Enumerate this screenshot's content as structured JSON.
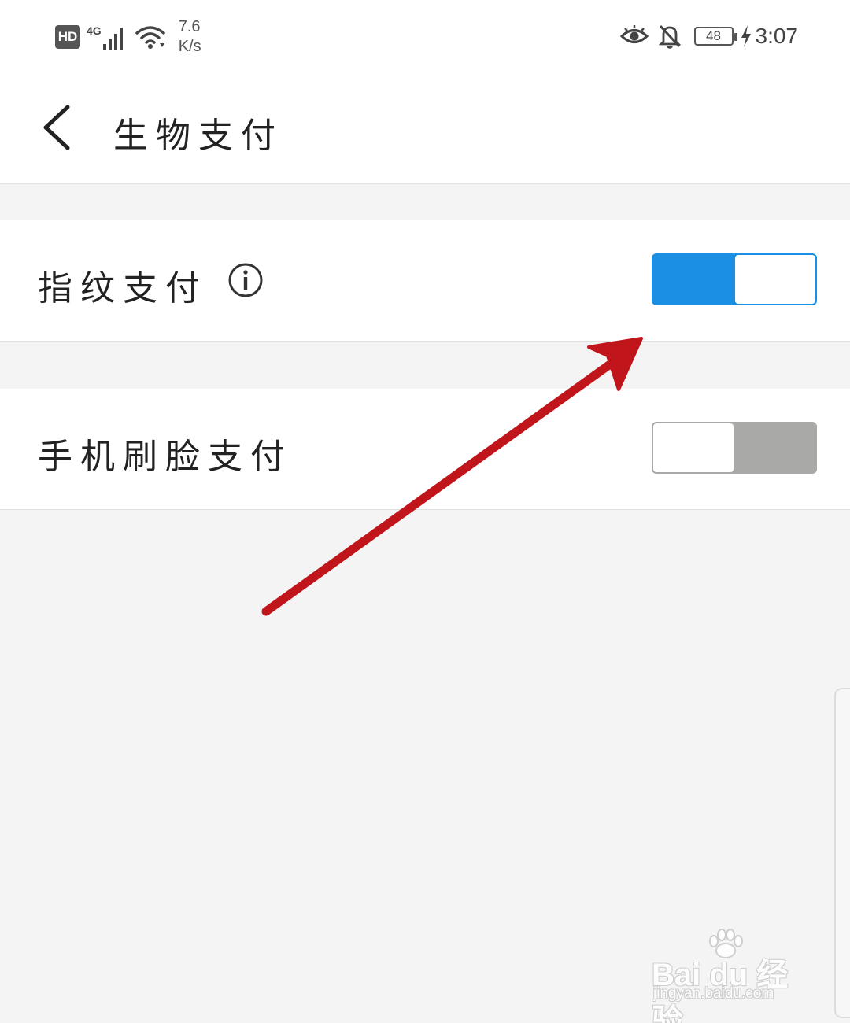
{
  "status_bar": {
    "hd": "HD",
    "network": "4G",
    "speed_value": "7.6",
    "speed_unit": "K/s",
    "battery": "48",
    "time": "3:07"
  },
  "header": {
    "title": "生物支付"
  },
  "settings": [
    {
      "label": "指纹支付",
      "enabled": true
    },
    {
      "label": "手机刷脸支付",
      "enabled": false
    }
  ],
  "colors": {
    "toggle_on": "#1a8fe3",
    "toggle_off": "#a9a9a7",
    "arrow": "#c0161b"
  },
  "watermark": {
    "main": "Bai du 经验",
    "sub": "jingyan.baidu.com"
  }
}
